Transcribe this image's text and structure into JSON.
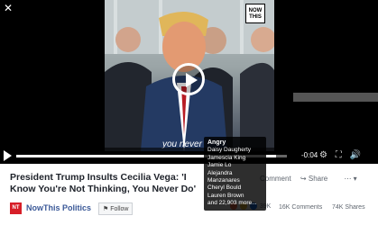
{
  "video": {
    "subtitle": "you never",
    "time_left": "-0:04",
    "logo": "NOW THIS",
    "progress": 0.96,
    "play_icon": "play-icon"
  },
  "post": {
    "title": "President Trump Insults Cecilia Vega: 'I Know You're Not Thinking, You Never Do'",
    "page_name": "NowThis Politics",
    "page_logo": "NT",
    "follow_label": "Follow",
    "comment_label": "Comment",
    "share_label": "Share",
    "reaction_count": "39K",
    "comments": "16K Comments",
    "shares": "74K Shares"
  },
  "tooltip": {
    "header": "Angry",
    "names": [
      "Daisy Daugherty",
      "Jamescia King",
      "Jamie Lo",
      "Alejandra Manzanares",
      "Cheryl Bould",
      "Lauren Brown"
    ],
    "more": "and 22,903 more..."
  },
  "colors": {
    "brand": "#3b5998",
    "nowthis_red": "#d71f28"
  }
}
